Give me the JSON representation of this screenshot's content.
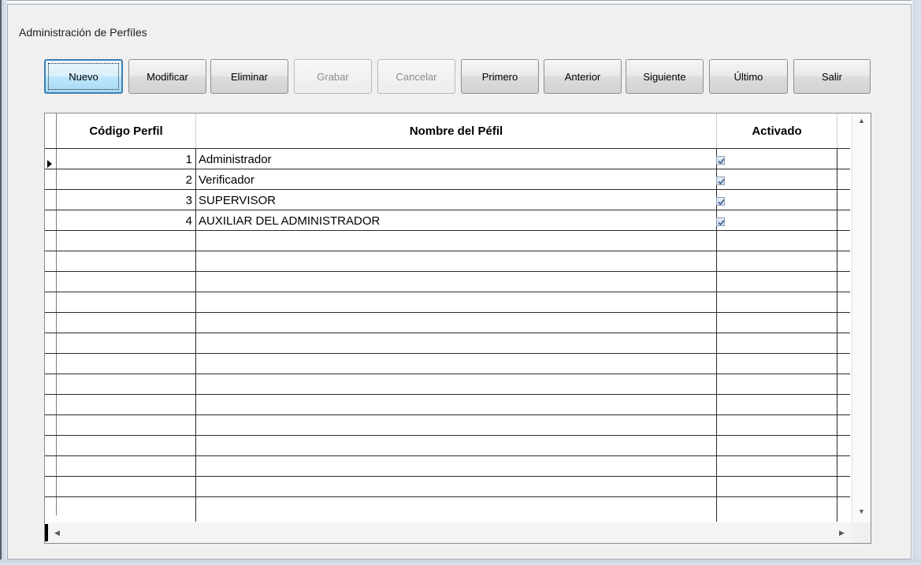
{
  "window": {
    "title": "Administración de Perfíles"
  },
  "toolbar": {
    "buttons": [
      {
        "label": "Nuevo",
        "state": "focused"
      },
      {
        "label": "Modificar",
        "state": "enabled"
      },
      {
        "label": "Eliminar",
        "state": "enabled"
      },
      {
        "label": "Grabar",
        "state": "disabled"
      },
      {
        "label": "Cancelar",
        "state": "disabled"
      },
      {
        "label": "Primero",
        "state": "enabled"
      },
      {
        "label": "Anterior",
        "state": "enabled"
      },
      {
        "label": "Siguiente",
        "state": "enabled"
      },
      {
        "label": "Último",
        "state": "enabled"
      },
      {
        "label": "Salir",
        "state": "enabled"
      }
    ]
  },
  "grid": {
    "columns": [
      "Código Perfil",
      "Nombre del Péfil",
      "Activado"
    ],
    "rows": [
      {
        "codigo": "1",
        "nombre": "Administrador",
        "activado": true
      },
      {
        "codigo": "2",
        "nombre": "Verificador",
        "activado": true
      },
      {
        "codigo": "3",
        "nombre": "SUPERVISOR",
        "activado": true
      },
      {
        "codigo": "4",
        "nombre": "AUXILIAR DEL ADMINISTRADOR",
        "activado": true
      }
    ],
    "current_row_indicator": "▸"
  },
  "icons": {
    "row_pointer": "row-pointer-icon",
    "scroll_up": "scroll-up-icon",
    "scroll_down": "scroll-down-icon",
    "scroll_left": "scroll-left-icon",
    "scroll_right": "scroll-right-icon",
    "checkbox": "checkbox-checked-icon"
  },
  "colors": {
    "focus_border": "#3c7fb1",
    "checkbox_border": "#8fa2b6",
    "check_mark": "#3b5f8a"
  }
}
